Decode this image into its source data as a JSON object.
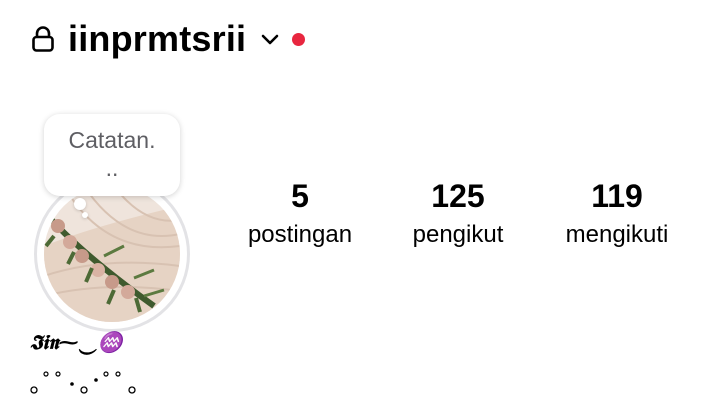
{
  "header": {
    "username": "iinprmtsrii",
    "status_color": "#e8263f",
    "icons": [
      "lock-icon",
      "chevron-down-icon"
    ]
  },
  "note": {
    "text_line1": "Catatan.",
    "text_line2": ".."
  },
  "stats": [
    {
      "value": "5",
      "label": "postingan"
    },
    {
      "value": "125",
      "label": "pengikut"
    },
    {
      "value": "119",
      "label": "mengikuti"
    }
  ],
  "bio": {
    "name": "𝕴𝖎𝖓⁓‿♒",
    "decoration": "。°˚°ॱ°˚°。"
  }
}
